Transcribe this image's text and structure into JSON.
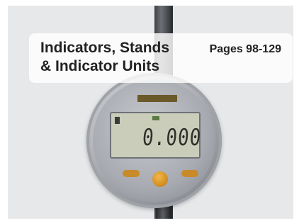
{
  "caption": {
    "title_line1": "Indicators, Stands",
    "title_line2": "& Indicator Units",
    "pages": "Pages 98-129"
  },
  "indicator": {
    "display_reading": "0.000"
  }
}
